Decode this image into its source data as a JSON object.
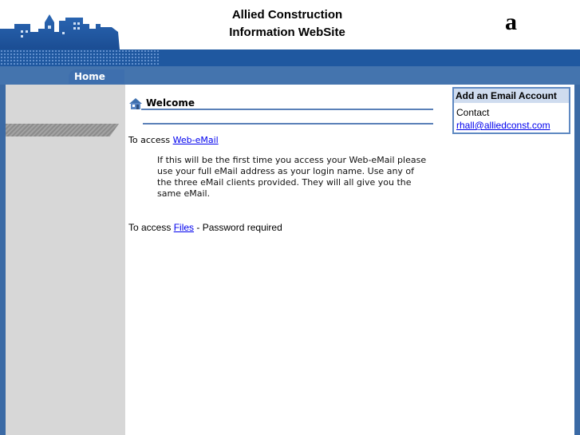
{
  "header": {
    "title_line1": "Allied Construction",
    "title_line2": "Information WebSite",
    "logo_text": "a"
  },
  "nav": {
    "home_label": "Home"
  },
  "main": {
    "welcome_title": "Welcome",
    "web_access_prefix": "To access ",
    "web_access_link": "Web-eMail",
    "web_note": "If this will be the first time you access your Web-eMail please use your full eMail address as your login name. Use any of the three eMail clients provided. They will all give you the same eMail.",
    "files_access_prefix": "To access ",
    "files_access_link": "Files",
    "files_access_suffix": " - Password required"
  },
  "email_box": {
    "title": "Add an Email Account",
    "contact_label": "Contact",
    "contact_email": "rhall@alliedconst.com"
  },
  "colors": {
    "brand_blue": "#1f58a0",
    "nav_blue": "#4474ae",
    "sidebar_gray": "#d7d7d7",
    "link": "#0000ee"
  }
}
